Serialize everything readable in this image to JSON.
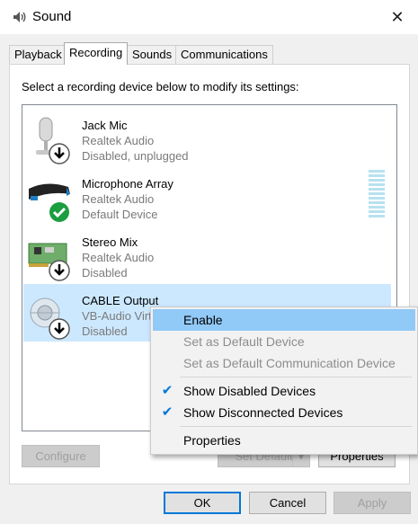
{
  "window": {
    "title": "Sound"
  },
  "tabs": [
    "Playback",
    "Recording",
    "Sounds",
    "Communications"
  ],
  "instruction": "Select a recording device below to modify its settings:",
  "devices": [
    {
      "name": "Jack Mic",
      "driver": "Realtek Audio",
      "status": "Disabled, unplugged",
      "icon": "microphone-icon",
      "badge": "disabled-arrow-icon"
    },
    {
      "name": "Microphone Array",
      "driver": "Realtek Audio",
      "status": "Default Device",
      "icon": "microphone-array-icon",
      "badge": "default-check-icon"
    },
    {
      "name": "Stereo Mix",
      "driver": "Realtek Audio",
      "status": "Disabled",
      "icon": "sound-card-icon",
      "badge": "disabled-arrow-icon"
    },
    {
      "name": "CABLE Output",
      "driver": "VB-Audio Virt",
      "status": "Disabled",
      "icon": "cable-icon",
      "badge": "disabled-arrow-icon"
    }
  ],
  "buttons": {
    "configure": "Configure",
    "set_default": "Set Default",
    "properties": "Properties",
    "ok": "OK",
    "cancel": "Cancel",
    "apply": "Apply"
  },
  "context_menu": {
    "items": [
      {
        "label": "Enable",
        "state": "highlighted"
      },
      {
        "label": "Set as Default Device",
        "state": "disabled"
      },
      {
        "label": "Set as Default Communication Device",
        "state": "disabled"
      },
      {
        "label": "Show Disabled Devices",
        "state": "checked"
      },
      {
        "label": "Show Disconnected Devices",
        "state": "checked"
      },
      {
        "label": "Properties",
        "state": "normal"
      }
    ]
  },
  "colors": {
    "selection": "#cce8ff",
    "menu_highlight": "#91c9f7",
    "accent": "#0078d7",
    "default_badge": "#1a9e3f"
  }
}
